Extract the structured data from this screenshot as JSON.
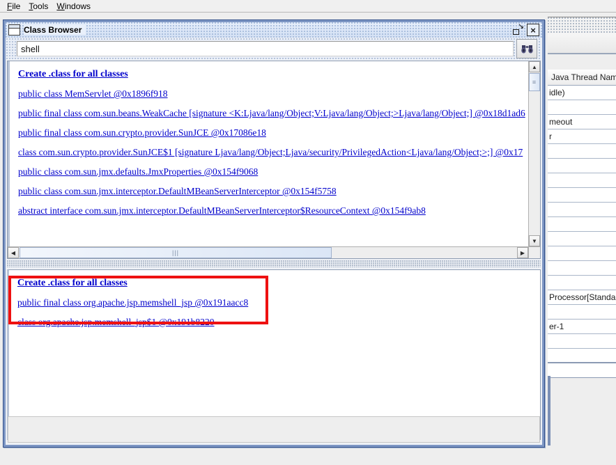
{
  "menubar": {
    "items": [
      {
        "label": "File",
        "mnemonic": "F"
      },
      {
        "label": "Tools",
        "mnemonic": "T"
      },
      {
        "label": "Windows",
        "mnemonic": "W"
      }
    ]
  },
  "window": {
    "title": "Class Browser",
    "icon": "window-frame-icon",
    "restore_label": "Restore",
    "close_label": "×"
  },
  "search": {
    "value": "shell",
    "placeholder": "",
    "find_button_icon": "binoculars-icon"
  },
  "top_panel": {
    "header_link": "Create .class for all classes",
    "items": [
      "public class MemServlet @0x1896f918",
      "public final class com.sun.beans.WeakCache [signature <K:Ljava/lang/Object;V:Ljava/lang/Object;>Ljava/lang/Object;] @0x18d1ad6",
      "public final class com.sun.crypto.provider.SunJCE @0x17086e18",
      "class com.sun.crypto.provider.SunJCE$1 [signature Ljava/lang/Object;Ljava/security/PrivilegedAction<Ljava/lang/Object;>;] @0x17",
      "public class com.sun.jmx.defaults.JmxProperties @0x154f9068",
      "public class com.sun.jmx.interceptor.DefaultMBeanServerInterceptor @0x154f5758",
      "abstract interface com.sun.jmx.interceptor.DefaultMBeanServerInterceptor$ResourceContext @0x154f9ab8"
    ]
  },
  "bottom_panel": {
    "header_link": "Create .class for all classes",
    "items": [
      "public final class org.apache.jsp.memshell_jsp @0x191aacc8",
      "class org.apache.jsp.memshell_jsp$1 @0x191b8220"
    ]
  },
  "scrollbars": {
    "up_arrow": "▲",
    "down_arrow": "▼",
    "left_arrow": "◀",
    "right_arrow": "▶",
    "grip": "|||"
  },
  "background_window": {
    "table_header": "Java Thread Nam",
    "rows": [
      "idle)",
      "",
      "meout",
      "r",
      "",
      "",
      "",
      "",
      "",
      "",
      "",
      "",
      "",
      "",
      "Processor[Standa",
      "",
      "er-1",
      "",
      "",
      "",
      ""
    ]
  },
  "annotation": {
    "color": "#ee1111"
  }
}
